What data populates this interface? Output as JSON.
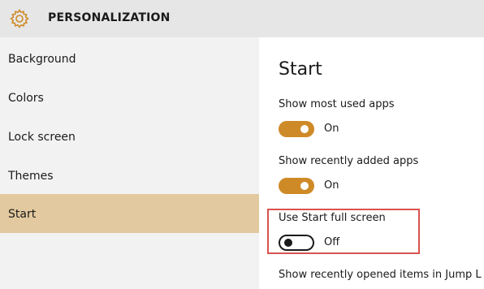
{
  "header": {
    "title": "PERSONALIZATION",
    "icon": "gear-icon",
    "icon_color": "#cf8a28"
  },
  "sidebar": {
    "items": [
      {
        "label": "Background",
        "selected": false
      },
      {
        "label": "Colors",
        "selected": false
      },
      {
        "label": "Lock screen",
        "selected": false
      },
      {
        "label": "Themes",
        "selected": false
      },
      {
        "label": "Start",
        "selected": true
      }
    ],
    "selected_color": "#e3c99f"
  },
  "main": {
    "title": "Start",
    "settings": [
      {
        "label": "Show most used apps",
        "state": "On",
        "on": true
      },
      {
        "label": "Show recently added apps",
        "state": "On",
        "on": true
      },
      {
        "label": "Use Start full screen",
        "state": "Off",
        "on": false
      },
      {
        "label": "Show recently opened items in Jump L"
      }
    ]
  },
  "colors": {
    "accent": "#cf8a28",
    "highlight_border": "#d9534f"
  }
}
